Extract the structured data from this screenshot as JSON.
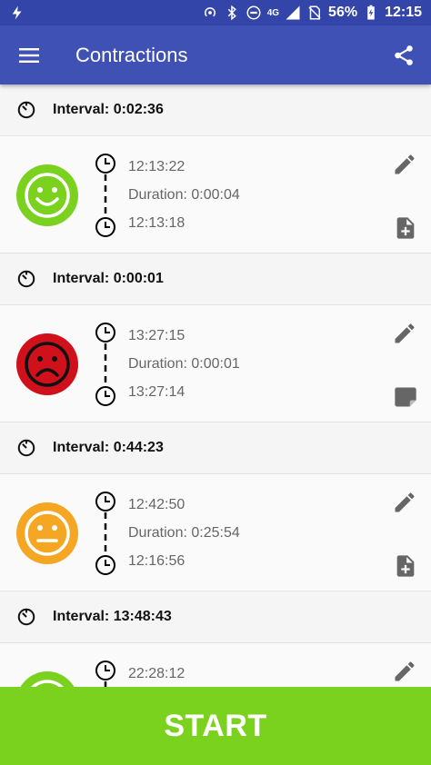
{
  "status_bar": {
    "network": "4G",
    "battery": "56%",
    "time": "12:15"
  },
  "app_bar": {
    "title": "Contractions"
  },
  "intervals": [
    "Interval: 0:02:36",
    "Interval: 0:00:01",
    "Interval: 0:44:23",
    "Interval: 13:48:43"
  ],
  "contractions": [
    {
      "mood": "happy",
      "color": "#7bd21e",
      "start": "12:13:22",
      "duration": "Duration: 0:00:04",
      "end": "12:13:18",
      "note_icon": "note-add-icon"
    },
    {
      "mood": "sad",
      "color": "#d0111b",
      "start": "13:27:15",
      "duration": "Duration: 0:00:01",
      "end": "13:27:14",
      "note_icon": "note-icon"
    },
    {
      "mood": "neutral",
      "color": "#f5a623",
      "start": "12:42:50",
      "duration": "Duration: 0:25:54",
      "end": "12:16:56",
      "note_icon": "note-add-icon"
    },
    {
      "mood": "happy",
      "color": "#7bd21e",
      "start": "22:28:12"
    }
  ],
  "start_button": {
    "label": "START",
    "color": "#7bd21e"
  }
}
